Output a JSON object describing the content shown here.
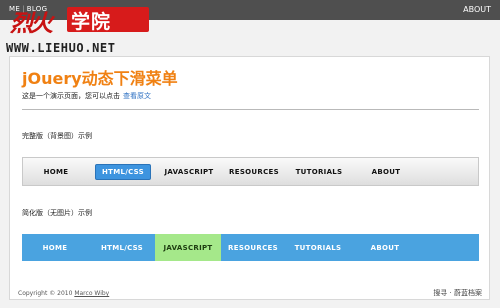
{
  "topbar": {
    "nav": [
      "ME",
      "BLOG"
    ],
    "about": "ABOUT"
  },
  "watermark": {
    "brush_text": "烈火",
    "box_text": "学院",
    "url": "WWW.LIEHUO.NET"
  },
  "page": {
    "title": "jOuery动态下滑菜单",
    "intro_text": "这是一个演示页面，您可以点击",
    "intro_link": "查看原文"
  },
  "section1": {
    "label": "完整版（背景图）示例",
    "items": [
      "HOME",
      "HTML/CSS",
      "JAVASCRIPT",
      "RESOURCES",
      "TUTORIALS",
      "ABOUT"
    ],
    "active_index": 1
  },
  "section2": {
    "label": "简化版（无图片）示例",
    "items": [
      "HOME",
      "HTML/CSS",
      "JAVASCRIPT",
      "RESOURCES",
      "TUTORIALS",
      "ABOUT"
    ],
    "active_index": 2
  },
  "footer": {
    "copyright": "Copyright © 2010",
    "author": "Marco Wiby",
    "right_text": "搜寻 · 蔚蓝档案"
  },
  "colors": {
    "topbar": "#4f4f4f",
    "title": "#f08113",
    "menu2_bg": "#4aa3e0",
    "menu2_active": "#a5e88a",
    "menu1_active": "#3d94df",
    "watermark_red": "#d71b1b"
  }
}
